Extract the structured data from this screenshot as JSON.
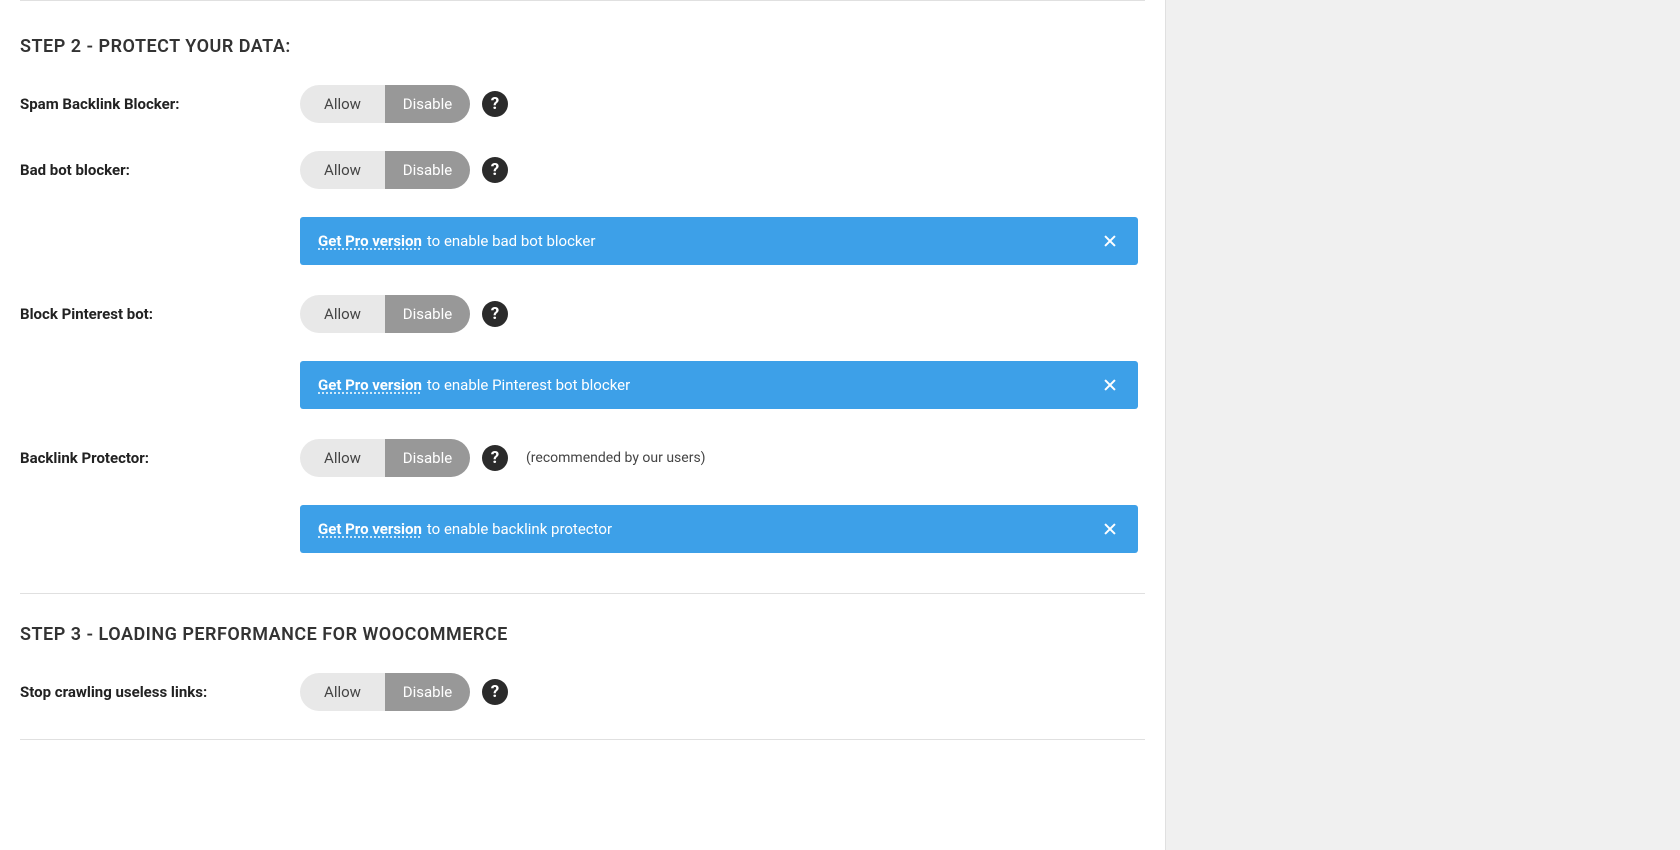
{
  "step2": {
    "heading": "STEP 2 - PROTECT YOUR DATA:",
    "rows": {
      "spam_backlink": {
        "label": "Spam Backlink Blocker:",
        "allow": "Allow",
        "disable": "Disable"
      },
      "bad_bot": {
        "label": "Bad bot blocker:",
        "allow": "Allow",
        "disable": "Disable"
      },
      "pinterest": {
        "label": "Block Pinterest bot:",
        "allow": "Allow",
        "disable": "Disable"
      },
      "backlink_protector": {
        "label": "Backlink Protector:",
        "allow": "Allow",
        "disable": "Disable",
        "note": "(recommended by our users)"
      }
    },
    "notices": {
      "bad_bot": {
        "link": "Get Pro version",
        "text": " to enable bad bot blocker"
      },
      "pinterest": {
        "link": "Get Pro version",
        "text": " to enable Pinterest bot blocker"
      },
      "backlink_protector": {
        "link": "Get Pro version",
        "text": " to enable backlink protector"
      }
    }
  },
  "step3": {
    "heading": "STEP 3 - LOADING PERFORMANCE FOR WOOCOMMERCE",
    "rows": {
      "stop_crawling": {
        "label": "Stop crawling useless links:",
        "allow": "Allow",
        "disable": "Disable"
      }
    }
  },
  "help_symbol": "?"
}
